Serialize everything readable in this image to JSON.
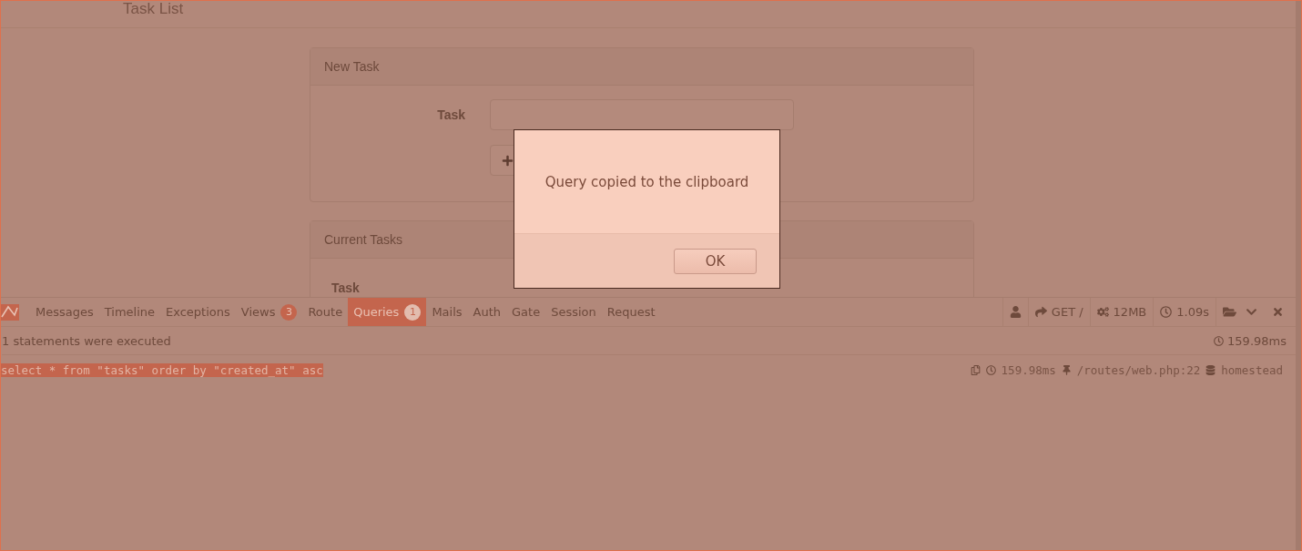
{
  "page": {
    "title": "Task List"
  },
  "new_task_panel": {
    "title": "New Task",
    "task_label": "Task"
  },
  "current_tasks_panel": {
    "title": "Current Tasks",
    "columns": [
      "Task"
    ]
  },
  "debugbar": {
    "tabs": [
      {
        "label": "Messages",
        "selected": false
      },
      {
        "label": "Timeline",
        "selected": false
      },
      {
        "label": "Exceptions",
        "selected": false
      },
      {
        "label": "Views",
        "badge": "3",
        "selected": false
      },
      {
        "label": "Route",
        "selected": false
      },
      {
        "label": "Queries",
        "badge": "1",
        "selected": true
      },
      {
        "label": "Mails",
        "selected": false
      },
      {
        "label": "Auth",
        "selected": false
      },
      {
        "label": "Gate",
        "selected": false
      },
      {
        "label": "Session",
        "selected": false
      },
      {
        "label": "Request",
        "selected": false
      }
    ],
    "status": {
      "request": "GET /",
      "memory": "12MB",
      "duration": "1.09s"
    },
    "summary": {
      "text": "1 statements were executed",
      "duration": "159.98ms"
    },
    "queries": [
      {
        "sql": "select * from \"tasks\" order by \"created_at\" asc",
        "highlighted": true,
        "duration": "159.98ms",
        "source": "/routes/web.php:22",
        "connection": "homestead"
      }
    ]
  },
  "dialog": {
    "message": "Query copied to the clipboard",
    "buttons": [
      "OK"
    ]
  }
}
